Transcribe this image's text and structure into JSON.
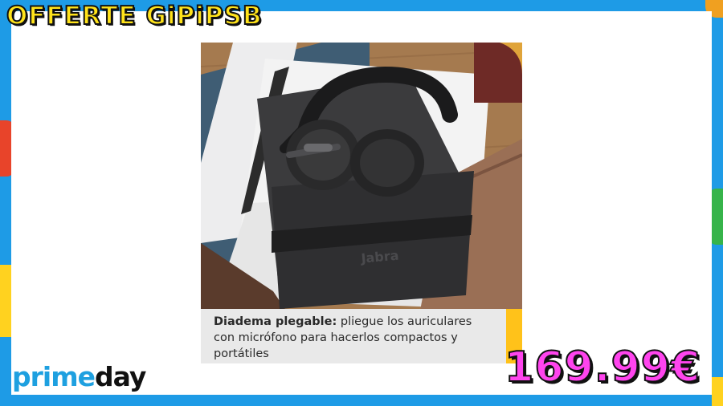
{
  "banner": {
    "title": "OFFERTE GiPiPSB"
  },
  "product": {
    "caption_bold": "Diadema plegable:",
    "caption_text": " pliegue los auriculares con micrófono para hacerlos compactos y portátiles",
    "bag_logo": "Jabra"
  },
  "brand": {
    "prime": "prime",
    "day": "day"
  },
  "price": {
    "value": "169.99€"
  },
  "colors": {
    "background": "#1e9be6",
    "title_fill": "#ffe31a",
    "price_fill": "#ff44ee",
    "prime_blue": "#1ea0e0",
    "caption_accent": "#ffc21a"
  }
}
